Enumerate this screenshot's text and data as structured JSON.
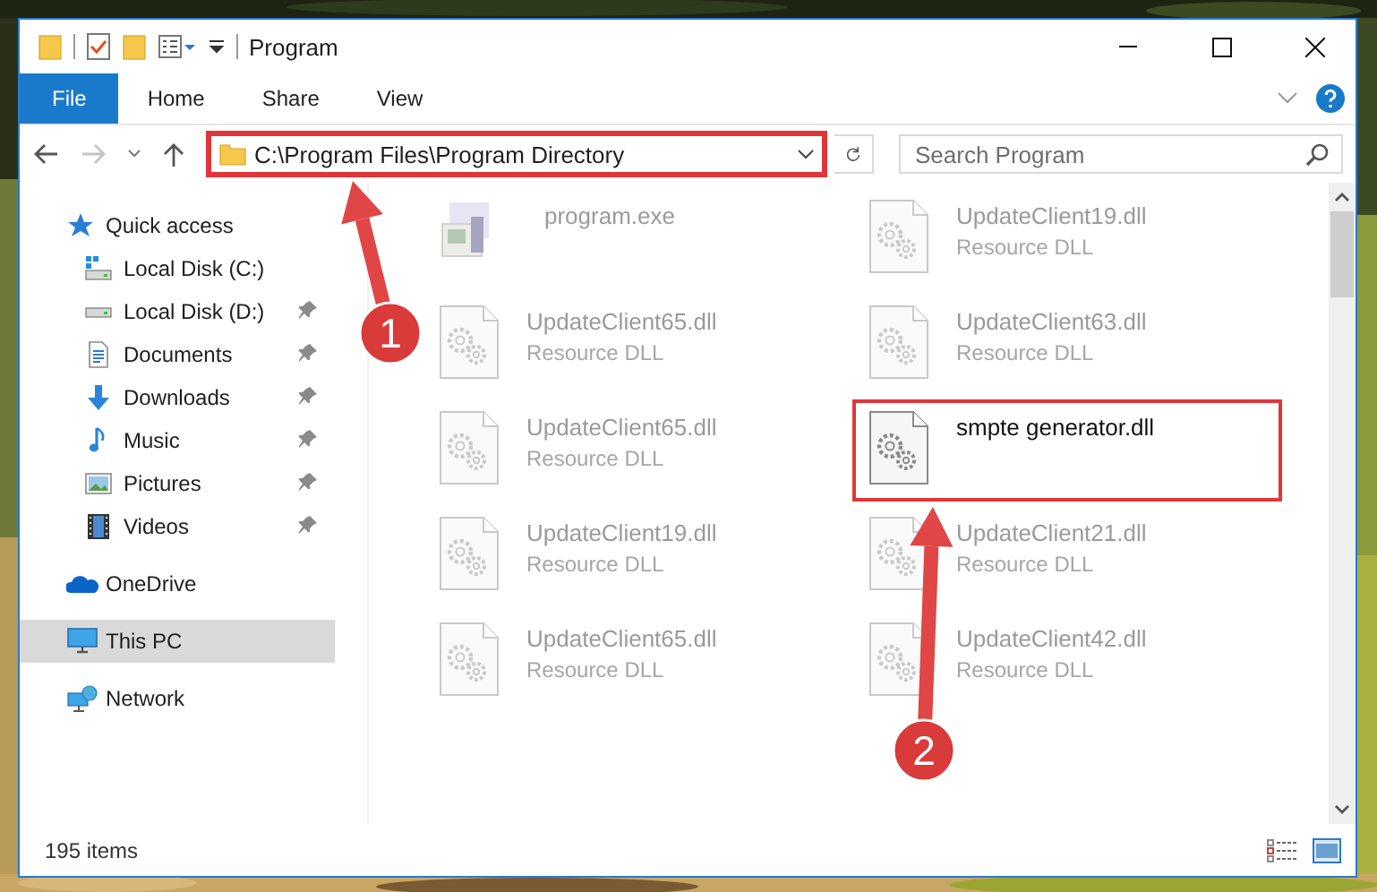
{
  "window": {
    "title": "Program"
  },
  "ribbon_tabs": [
    {
      "label": "File",
      "selected": true
    },
    {
      "label": "Home",
      "selected": false
    },
    {
      "label": "Share",
      "selected": false
    },
    {
      "label": "View",
      "selected": false
    }
  ],
  "address": {
    "value": "C:\\Program Files\\Program Directory",
    "highlighted": true
  },
  "search": {
    "placeholder": "Search Program"
  },
  "nav": [
    {
      "label": "Quick access",
      "selected": false,
      "children": [
        {
          "label": "Local Disk (C:)",
          "pinned": false,
          "selected": false
        },
        {
          "label": "Local Disk (D:)",
          "pinned": true,
          "selected": false
        },
        {
          "label": "Documents",
          "pinned": true,
          "selected": false
        },
        {
          "label": "Downloads",
          "pinned": true,
          "selected": false
        },
        {
          "label": "Music",
          "pinned": true,
          "selected": false
        },
        {
          "label": "Pictures",
          "pinned": true,
          "selected": false
        },
        {
          "label": "Videos",
          "pinned": true,
          "selected": false
        }
      ]
    },
    {
      "label": "OneDrive",
      "selected": false
    },
    {
      "label": "This PC",
      "selected": true
    },
    {
      "label": "Network",
      "selected": false
    }
  ],
  "files": [
    {
      "kind": "exe",
      "name": "program.exe",
      "faded": true,
      "highlighted": false
    },
    {
      "kind": "dll",
      "name": "UpdateClient19.dll",
      "type": "Resource DLL",
      "faded": true,
      "highlighted": false
    },
    {
      "kind": "dll",
      "name": "UpdateClient65.dll",
      "type": "Resource DLL",
      "faded": true,
      "highlighted": false
    },
    {
      "kind": "dll",
      "name": "UpdateClient63.dll",
      "type": "Resource DLL",
      "faded": true,
      "highlighted": false
    },
    {
      "kind": "dll",
      "name": "UpdateClient65.dll",
      "type": "Resource DLL",
      "faded": true,
      "highlighted": false
    },
    {
      "kind": "dll",
      "name": "smpte generator.dll",
      "faded": false,
      "highlighted": true
    },
    {
      "kind": "dll",
      "name": "UpdateClient19.dll",
      "type": "Resource DLL",
      "faded": true,
      "highlighted": false
    },
    {
      "kind": "dll",
      "name": "UpdateClient21.dll",
      "type": "Resource DLL",
      "faded": true,
      "highlighted": false
    },
    {
      "kind": "dll",
      "name": "UpdateClient65.dll",
      "type": "Resource DLL",
      "faded": true,
      "highlighted": false
    },
    {
      "kind": "dll",
      "name": "UpdateClient42.dll",
      "type": "Resource DLL",
      "faded": true,
      "highlighted": false
    }
  ],
  "callouts": [
    {
      "label": "1"
    },
    {
      "label": "2"
    }
  ],
  "status_bar": {
    "count": "195 items"
  }
}
